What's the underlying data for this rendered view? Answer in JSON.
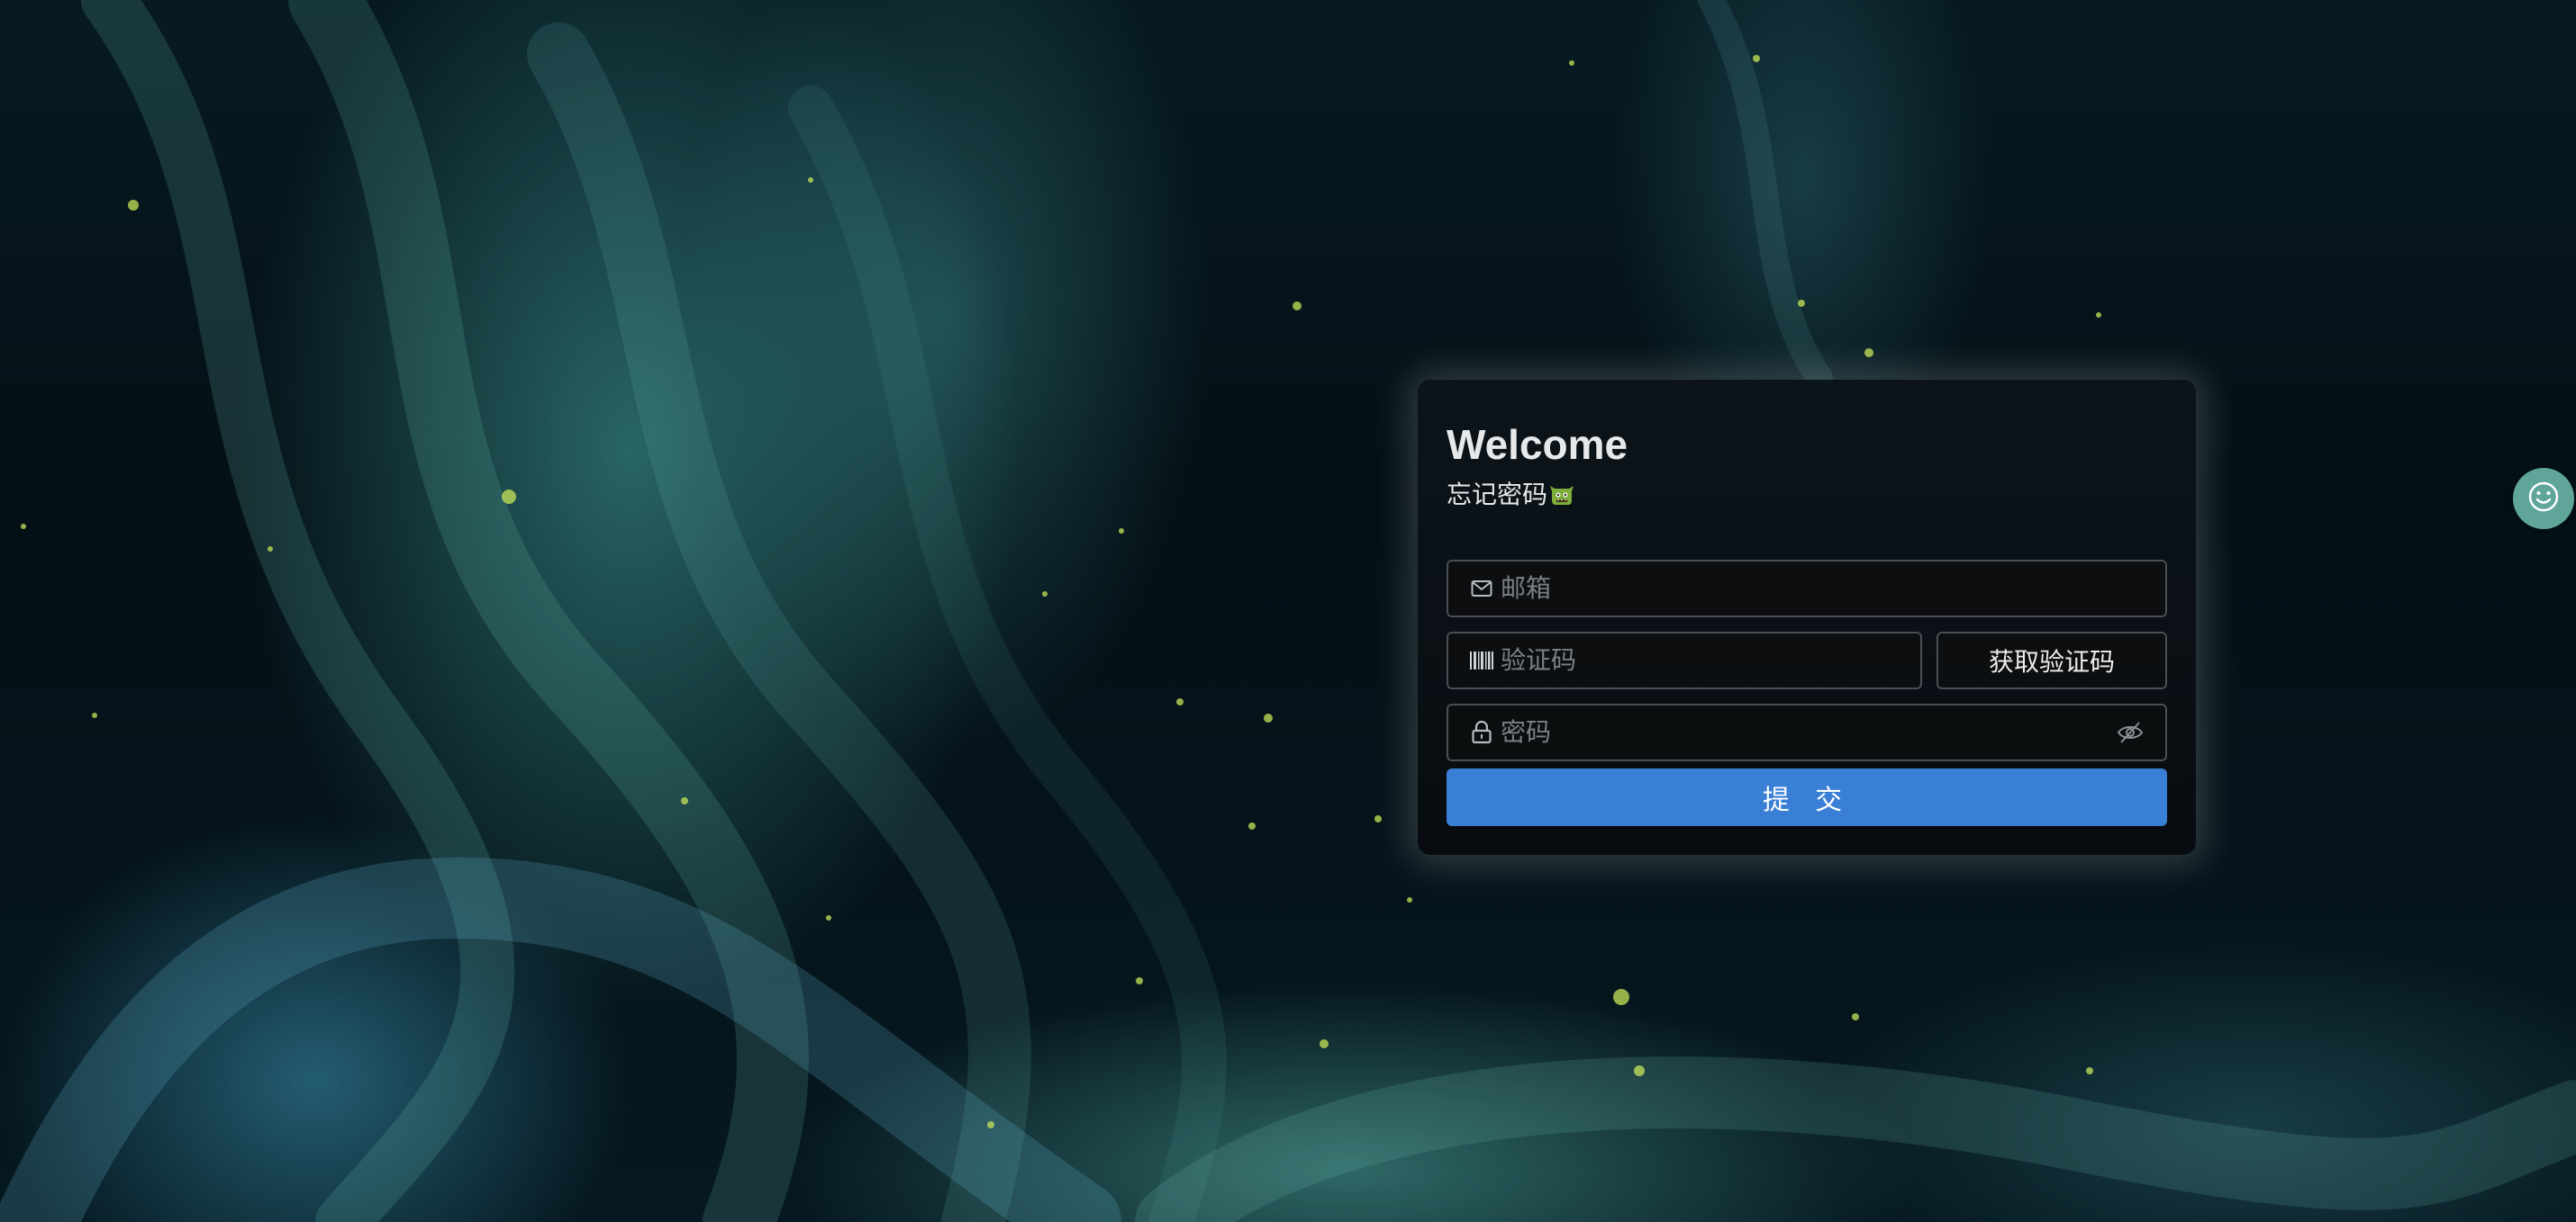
{
  "login": {
    "title": "Welcome",
    "forgot_password": "忘记密码",
    "email": {
      "placeholder": "邮箱",
      "icon": "mail-icon"
    },
    "code": {
      "placeholder": "验证码",
      "icon": "barcode-icon"
    },
    "get_code_label": "获取验证码",
    "password": {
      "placeholder": "密码",
      "icon": "lock-icon",
      "toggle_icon": "eye-off-icon"
    },
    "submit_label": "提 交"
  },
  "floating": {
    "icon": "smile-icon"
  },
  "colors": {
    "accent": "#3a7fd6",
    "card_bg": "#0b1116",
    "float_button": "#5fa59a"
  }
}
